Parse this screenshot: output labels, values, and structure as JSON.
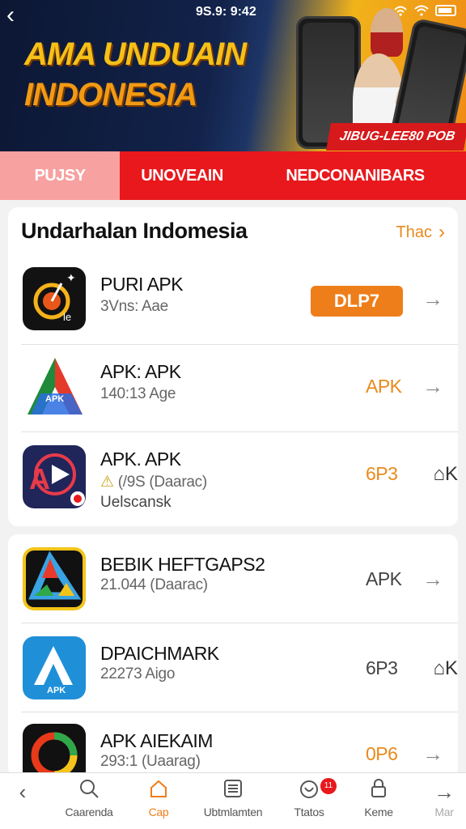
{
  "status_bar": {
    "time": "9S.9: 9:42"
  },
  "banner": {
    "title_line1": "AMA UNDUAIN",
    "title_line2": "INDONESIA",
    "tag": "JIBUG-LEE80 POB"
  },
  "tabs": [
    {
      "label": "PUJSY"
    },
    {
      "label": "UNOVEAIN"
    },
    {
      "label": "NEDCONANIBARS"
    }
  ],
  "section1": {
    "title": "Undarhalan Indomesia",
    "more_label": "Thac",
    "apps": [
      {
        "name": "PURI APK",
        "sub": "3Vns: Aae",
        "action": "DLP7",
        "icon": "target-timer-icon"
      },
      {
        "name": "APK: APK",
        "sub": "140:13 Age",
        "action": "APK",
        "icon": "a-triangle-icon"
      },
      {
        "name": "APK. APK",
        "sub": "(/9S (Daarac)",
        "extra": "Uelscansk",
        "action": "6P3",
        "bookmark": "K",
        "icon": "a-play-icon"
      }
    ]
  },
  "section2": {
    "apps": [
      {
        "name": "BEBIK HEFTGAPS2",
        "sub": "21.044 (Daarac)",
        "action": "APK",
        "icon": "delta-icon"
      },
      {
        "name": "DPAICHMARK",
        "sub": "22273 Aigo",
        "action": "6P3",
        "bookmark": "K",
        "icon": "a-apk-icon",
        "icon_text": "APK"
      },
      {
        "name": "APK AIEKAIM",
        "sub": "293:1 (Uaarag)",
        "action": "0P6",
        "icon": "ring-icon"
      }
    ]
  },
  "bottom_nav": [
    {
      "label": "",
      "icon": "back-chevron-icon"
    },
    {
      "label": "Caarenda",
      "icon": "search-icon"
    },
    {
      "label": "Cap",
      "icon": "home-icon",
      "active": true
    },
    {
      "label": "Ubtmlamten",
      "icon": "list-icon"
    },
    {
      "label": "Ttatos",
      "icon": "heart-icon",
      "badge": "11"
    },
    {
      "label": "Keme",
      "icon": "lock-icon"
    },
    {
      "label": "Mar",
      "icon": "forward-arrow-icon"
    }
  ],
  "colors": {
    "accent": "#ee7e1a",
    "tab_red": "#e8181c",
    "tab_pink": "#f7a1a1"
  }
}
